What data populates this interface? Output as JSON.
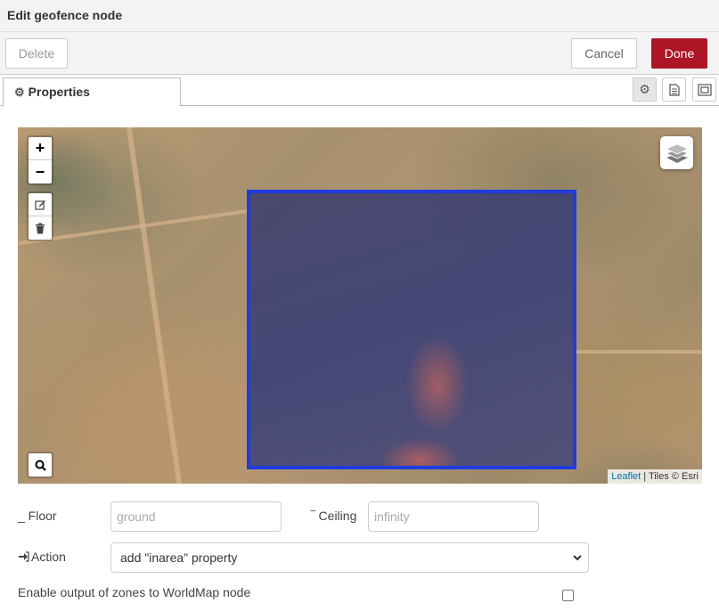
{
  "title": "Edit geofence node",
  "toolbar": {
    "delete_label": "Delete",
    "cancel_label": "Cancel",
    "done_label": "Done"
  },
  "tabs": {
    "properties_label": "Properties",
    "icons": [
      "gear-icon",
      "description-icon",
      "appearance-icon"
    ]
  },
  "map": {
    "zoom_in": "+",
    "zoom_out": "−",
    "attribution_link": "Leaflet",
    "attribution_text": "| Tiles © Esri"
  },
  "form": {
    "floor_label": "_ Floor",
    "floor_placeholder": "ground",
    "ceiling_label": "‾ Ceiling",
    "ceiling_placeholder": "infinity",
    "action_label": "Action",
    "action_value": "add \"inarea\" property",
    "enable_output_label": "Enable output of zones to WorldMap node",
    "enable_output_checked": false
  },
  "colors": {
    "done_button": "#ad1625",
    "geofence_stroke": "#1e3ce0"
  }
}
